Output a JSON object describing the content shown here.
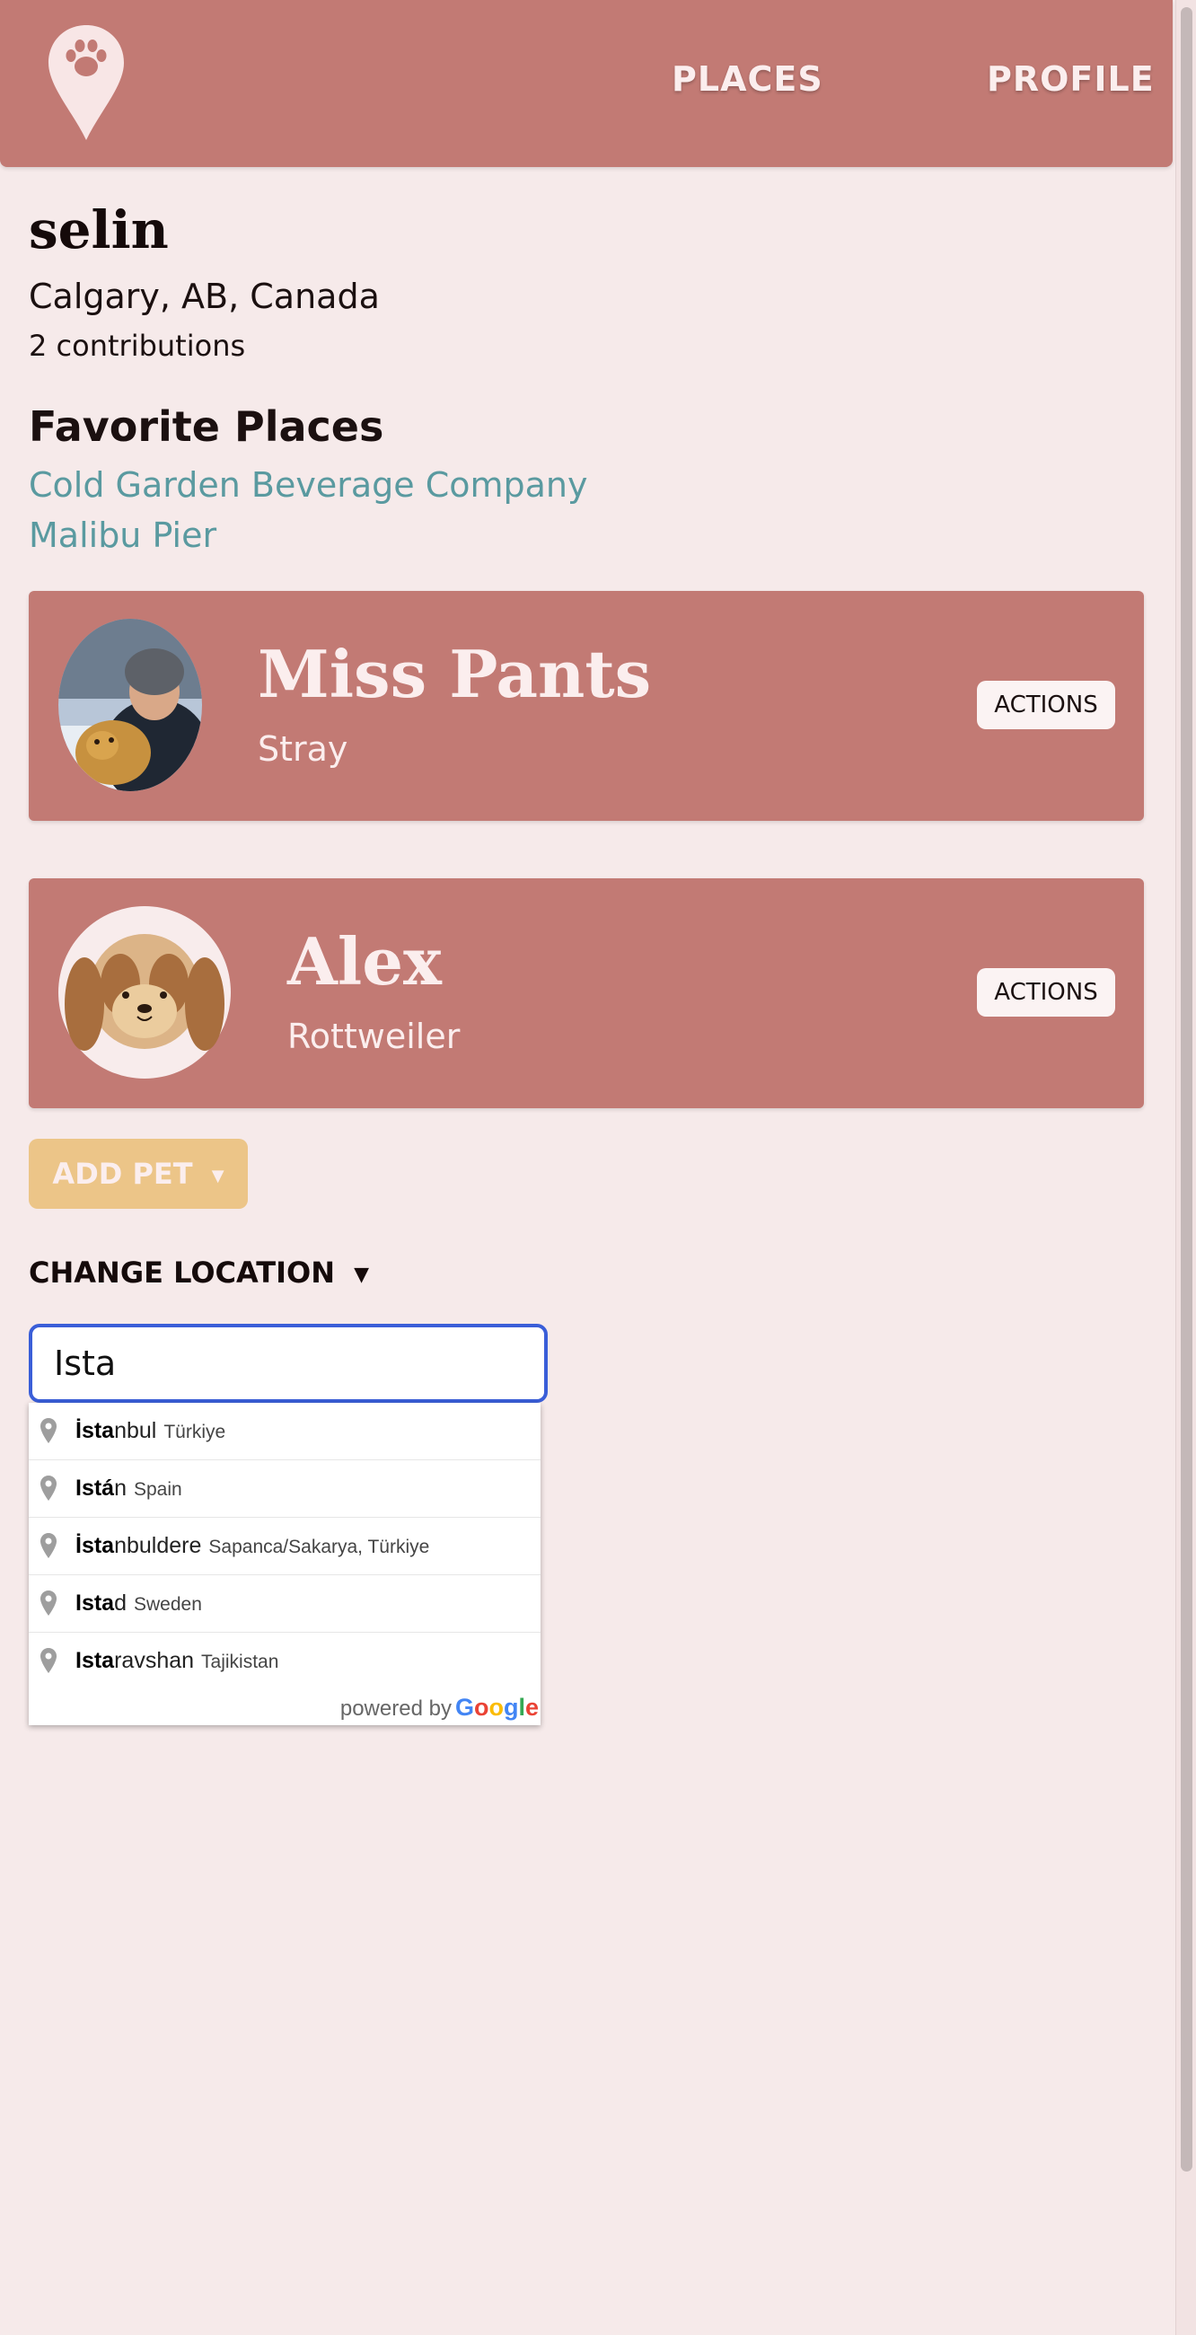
{
  "nav": {
    "places": "PLACES",
    "profile": "PROFILE"
  },
  "user": {
    "name": "selin",
    "location": "Calgary, AB, Canada",
    "contributions": "2 contributions"
  },
  "favorites": {
    "title": "Favorite Places",
    "items": [
      "Cold Garden Beverage Company",
      "Malibu Pier"
    ]
  },
  "pets": [
    {
      "name": "Miss Pants",
      "breed": "Stray",
      "actions_label": "ACTIONS"
    },
    {
      "name": "Alex",
      "breed": "Rottweiler",
      "actions_label": "ACTIONS"
    }
  ],
  "add_pet_label": "ADD PET",
  "change_location_label": "CHANGE LOCATION",
  "location_input": {
    "value": "Ista"
  },
  "suggestions": [
    {
      "match": "İsta",
      "rest": "nbul",
      "secondary": "Türkiye"
    },
    {
      "match": "Istá",
      "rest": "n",
      "secondary": "Spain"
    },
    {
      "match": "İsta",
      "rest": "nbuldere",
      "secondary": "Sapanca/Sakarya, Türkiye"
    },
    {
      "match": "Ista",
      "rest": "d",
      "secondary": "Sweden"
    },
    {
      "match": "Ista",
      "rest": "ravshan",
      "secondary": "Tajikistan"
    }
  ],
  "powered_by": "powered by",
  "google_letters": [
    "G",
    "o",
    "o",
    "g",
    "l",
    "e"
  ],
  "colors": {
    "header": "#c27a74",
    "background": "#f6eaea",
    "link": "#5a9aa0",
    "add_pet": "#ecc588",
    "input_focus": "#3a5ed8"
  }
}
